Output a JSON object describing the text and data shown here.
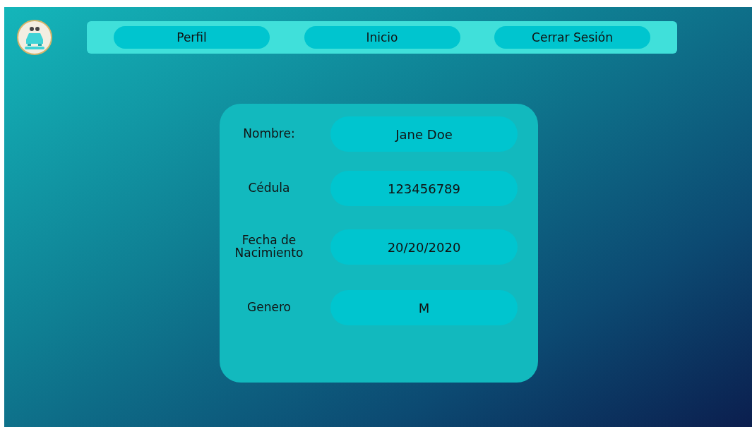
{
  "nav": {
    "items": [
      {
        "label": "Perfil"
      },
      {
        "label": "Inicio"
      },
      {
        "label": "Cerrar Sesión"
      }
    ]
  },
  "profile": {
    "fields": [
      {
        "label": "Nombre:",
        "value": "Jane Doe"
      },
      {
        "label": "Cédula",
        "value": "123456789"
      },
      {
        "label": "Fecha de Nacimiento",
        "value": "20/20/2020"
      },
      {
        "label": "Genero",
        "value": "M"
      }
    ]
  }
}
